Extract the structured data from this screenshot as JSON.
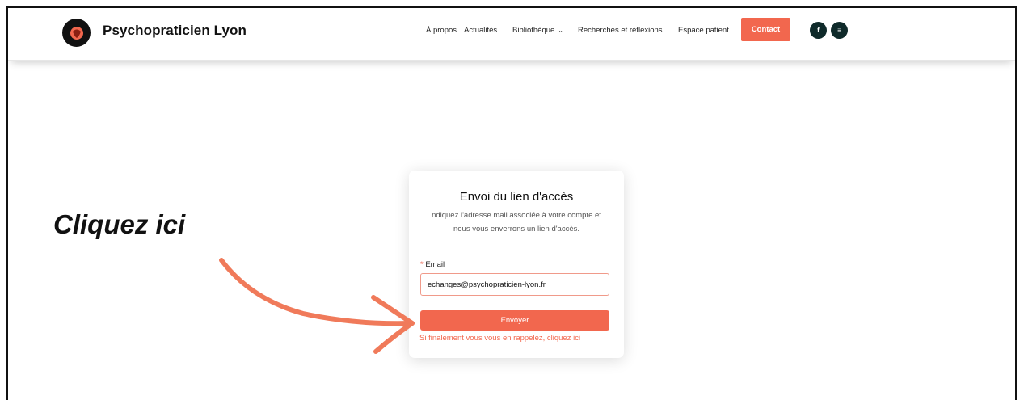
{
  "site": {
    "brand": "Psychopraticien Lyon"
  },
  "nav": {
    "items": [
      "À propos",
      "Actualités",
      "Bibliothèque",
      "Recherches et réflexions",
      "Espace patient"
    ],
    "contact_label": "Contact"
  },
  "social": [
    {
      "icon": "facebook-icon",
      "glyph": "f"
    },
    {
      "icon": "spotify-icon",
      "glyph": "≡"
    }
  ],
  "card": {
    "title": "Envoi du lien d'accès",
    "description": "ndiquez l'adresse mail associée à votre compte et nous vous enverrons un lien d'accès.",
    "email_label": "Email",
    "email_required_mark": "*",
    "email_value": "echanges@psychopraticien-lyon.fr",
    "submit_label": "Envoyer",
    "recall_link": "Si finalement vous vous en rappelez, cliquez ici"
  },
  "annotation": {
    "text": "Cliquez ici"
  },
  "colors": {
    "accent": "#f2674e",
    "dark": "#0f2a2a",
    "arrow": "#f07a5a"
  }
}
